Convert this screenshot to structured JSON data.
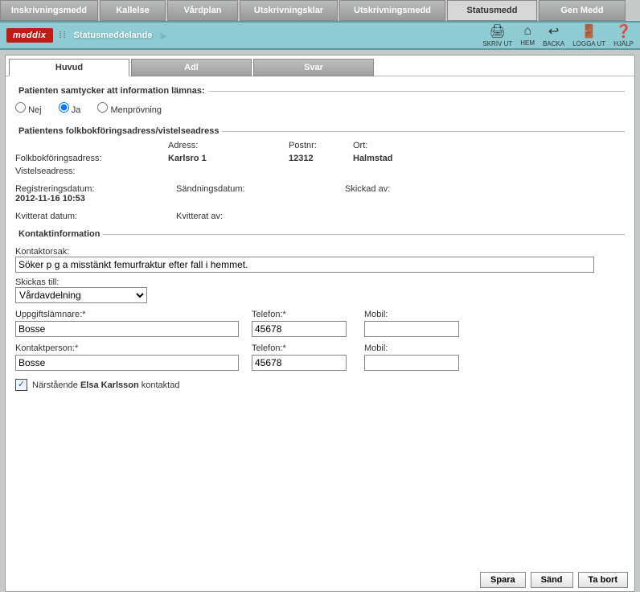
{
  "topTabs": {
    "inskrivningsmedd": "Inskrivningsmedd",
    "kallelse": "Kallelse",
    "vardplan": "Vårdplan",
    "utskrivningsklar": "Utskrivningsklar",
    "utskrivningsmedd": "Utskrivningsmedd",
    "statusmedd": "Statusmedd",
    "genmedd": "Gen Medd"
  },
  "header": {
    "logo": "meddix",
    "title": "Statusmeddelande",
    "icons": {
      "print": "SKRIV UT",
      "home": "HEM",
      "back": "BACKA",
      "logout": "LOGGA UT",
      "help": "HJÄLP"
    }
  },
  "subTabs": {
    "huvud": "Huvud",
    "adl": "Adl",
    "svar": "Svar"
  },
  "consent": {
    "legend": "Patienten samtycker att information lämnas:",
    "nej": "Nej",
    "ja": "Ja",
    "menprovning": "Menprövning"
  },
  "address": {
    "legend": "Patientens folkbokföringsadress/vistelseadress",
    "adressLabel": "Adress:",
    "postnrLabel": "Postnr:",
    "ortLabel": "Ort:",
    "folkbokLabel": "Folkbokföringsadress:",
    "vistelseLabel": "Vistelseadress:",
    "adressVal": "Karlsro 1",
    "postnrVal": "12312",
    "ortVal": "Halmstad"
  },
  "meta": {
    "regLabel": "Registreringsdatum:",
    "regVal": "2012-11-16 10:53",
    "sandLabel": "Sändningsdatum:",
    "skickadLabel": "Skickad av:",
    "kvittDatumLabel": "Kvitterat datum:",
    "kvittAvLabel": "Kvitterat av:"
  },
  "kontakt": {
    "legend": "Kontaktinformation",
    "orsakLabel": "Kontaktorsak:",
    "orsakVal": "Söker p g a misstänkt femurfraktur efter fall i hemmet.",
    "skickasLabel": "Skickas till:",
    "skickasVal": "Vårdavdelning",
    "uppgiftLabel": "Uppgiftslämnare:*",
    "telefonLabel": "Telefon:*",
    "mobilLabel": "Mobil:",
    "uppgiftName": "Bosse",
    "uppgiftTel": "45678",
    "kontaktpersonLabel": "Kontaktperson:*",
    "kontaktpersonName": "Bosse",
    "kontaktpersonTel": "45678",
    "narLabel1": "Närstående ",
    "narLabel2": "Elsa Karlsson",
    "narLabel3": " kontaktad"
  },
  "footer": {
    "spara": "Spara",
    "sand": "Sänd",
    "tabort": "Ta bort"
  }
}
